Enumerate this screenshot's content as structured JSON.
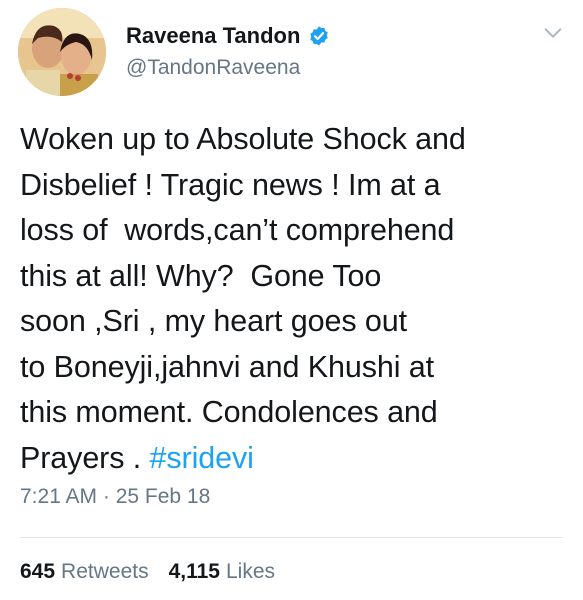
{
  "author": {
    "display_name": "Raveena Tandon",
    "handle": "@TandonRaveena",
    "verified": true
  },
  "tweet": {
    "lines": [
      "Woken up to Absolute Shock and",
      "Disbelief ! Tragic news ! Im at a",
      "loss of  words,can’t comprehend",
      "this at all! Why?  Gone Too",
      "soon ,Sri , my heart goes out",
      "to Boneyji,jahnvi and Khushi at",
      "this moment. Condolences and"
    ],
    "last_line_prefix": "Prayers . ",
    "hashtag": "#sridevi",
    "timestamp": "7:21 AM · 25 Feb 18"
  },
  "stats": {
    "retweets_count": "645",
    "retweets_label": "Retweets",
    "likes_count": "4,115",
    "likes_label": "Likes"
  },
  "colors": {
    "accent": "#1da1f2",
    "text": "#14171a",
    "secondary_text": "#657786",
    "divider": "#e1e8ed"
  },
  "icons": {
    "verified": "verified-badge-icon",
    "menu": "chevron-down-icon"
  }
}
